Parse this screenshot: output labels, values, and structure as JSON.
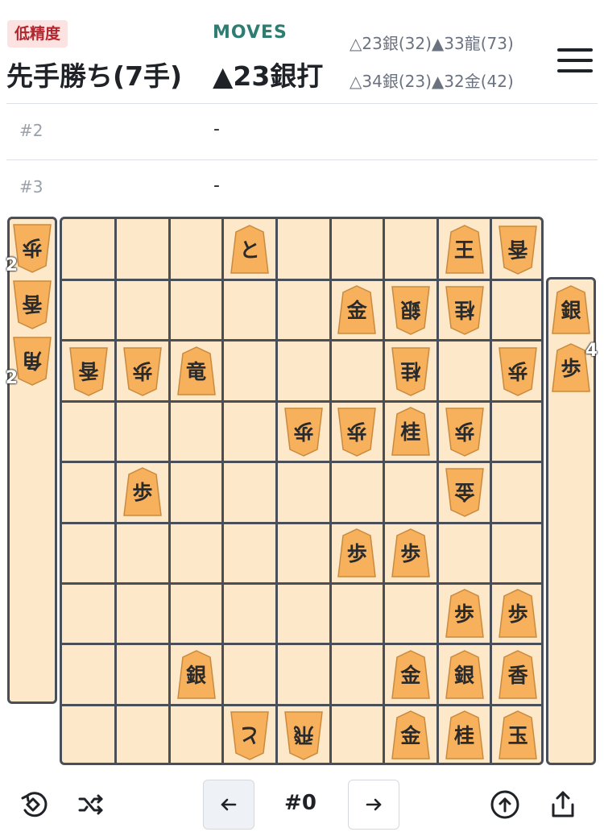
{
  "header": {
    "badge": "低精度",
    "result": "先手勝ち(7手)",
    "moves_label": "MOVES",
    "current_move": "▲23銀打",
    "candidates_line1": "△23銀(32)▲33龍(73)",
    "candidates_line2": "△34銀(23)▲32金(42)"
  },
  "moves": [
    {
      "num": "#2",
      "move": "-"
    },
    {
      "num": "#3",
      "move": "-"
    }
  ],
  "hands": {
    "gote": [
      {
        "char": "歩",
        "count": "2"
      },
      {
        "char": "香",
        "count": ""
      },
      {
        "char": "角",
        "count": "2"
      }
    ],
    "sente": [
      {
        "char": "銀",
        "count": ""
      },
      {
        "char": "歩",
        "count": "4"
      }
    ]
  },
  "board": [
    {
      "row": 0,
      "col": 3,
      "char": "と",
      "side": "sente"
    },
    {
      "row": 0,
      "col": 7,
      "char": "王",
      "side": "sente"
    },
    {
      "row": 0,
      "col": 8,
      "char": "香",
      "side": "gote"
    },
    {
      "row": 1,
      "col": 5,
      "char": "金",
      "side": "sente"
    },
    {
      "row": 1,
      "col": 6,
      "char": "銀",
      "side": "gote"
    },
    {
      "row": 1,
      "col": 7,
      "char": "桂",
      "side": "gote"
    },
    {
      "row": 2,
      "col": 0,
      "char": "香",
      "side": "gote"
    },
    {
      "row": 2,
      "col": 1,
      "char": "歩",
      "side": "gote"
    },
    {
      "row": 2,
      "col": 2,
      "char": "竜",
      "side": "sente"
    },
    {
      "row": 2,
      "col": 6,
      "char": "桂",
      "side": "gote"
    },
    {
      "row": 2,
      "col": 8,
      "char": "歩",
      "side": "gote"
    },
    {
      "row": 3,
      "col": 4,
      "char": "歩",
      "side": "gote"
    },
    {
      "row": 3,
      "col": 5,
      "char": "歩",
      "side": "gote"
    },
    {
      "row": 3,
      "col": 6,
      "char": "桂",
      "side": "sente"
    },
    {
      "row": 3,
      "col": 7,
      "char": "歩",
      "side": "gote"
    },
    {
      "row": 4,
      "col": 1,
      "char": "歩",
      "side": "sente"
    },
    {
      "row": 4,
      "col": 7,
      "char": "金",
      "side": "gote"
    },
    {
      "row": 5,
      "col": 5,
      "char": "歩",
      "side": "sente"
    },
    {
      "row": 5,
      "col": 6,
      "char": "歩",
      "side": "sente"
    },
    {
      "row": 6,
      "col": 7,
      "char": "歩",
      "side": "sente"
    },
    {
      "row": 6,
      "col": 8,
      "char": "歩",
      "side": "sente"
    },
    {
      "row": 7,
      "col": 2,
      "char": "銀",
      "side": "sente"
    },
    {
      "row": 7,
      "col": 6,
      "char": "金",
      "side": "sente"
    },
    {
      "row": 7,
      "col": 7,
      "char": "銀",
      "side": "sente"
    },
    {
      "row": 7,
      "col": 8,
      "char": "香",
      "side": "sente"
    },
    {
      "row": 8,
      "col": 3,
      "char": "と",
      "side": "gote"
    },
    {
      "row": 8,
      "col": 4,
      "char": "飛",
      "side": "gote"
    },
    {
      "row": 8,
      "col": 6,
      "char": "金",
      "side": "sente"
    },
    {
      "row": 8,
      "col": 7,
      "char": "桂",
      "side": "sente"
    },
    {
      "row": 8,
      "col": 8,
      "char": "玉",
      "side": "sente"
    }
  ],
  "toolbar": {
    "move_index": "#0",
    "icons": [
      "rotate-board-icon",
      "shuffle-icon",
      "arrow-left-icon",
      "arrow-right-icon",
      "upload-circle-icon",
      "share-icon"
    ]
  },
  "colors": {
    "piece_fill": "#f7b05c",
    "board_bg": "#fde9c9",
    "grid": "#4a4f57",
    "accent_moves": "#2e7d72",
    "badge_bg": "#fde2e2",
    "badge_text": "#b3262e"
  }
}
